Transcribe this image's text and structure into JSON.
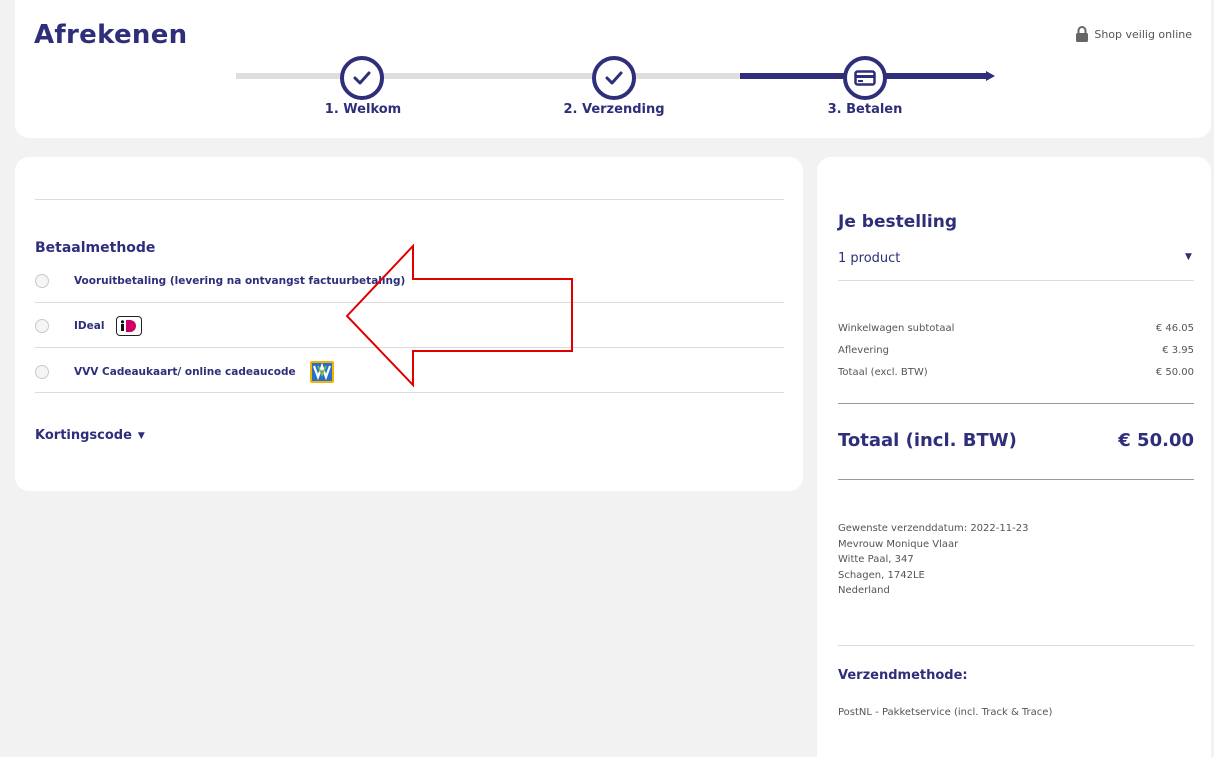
{
  "header": {
    "title": "Afrekenen",
    "secure_label": "Shop veilig online",
    "secure_icon": "lock-icon"
  },
  "stepper": {
    "steps": [
      {
        "label": "1. Welkom",
        "state": "done",
        "icon": "check-icon"
      },
      {
        "label": "2. Verzending",
        "state": "done",
        "icon": "check-icon"
      },
      {
        "label": "3. Betalen",
        "state": "current",
        "icon": "credit-card-icon"
      }
    ]
  },
  "payment": {
    "title": "Betaalmethode",
    "options": [
      {
        "label": "Vooruitbetaling (levering na ontvangst factuurbetaling)",
        "selected": false
      },
      {
        "label": "IDeal",
        "selected": false,
        "logo": "ideal-logo"
      },
      {
        "label": "VVV Cadeaukaart/ online cadeaucode",
        "selected": false,
        "logo": "vvv-logo"
      }
    ],
    "discount_label": "Kortingscode",
    "discount_caret": "▼"
  },
  "order": {
    "title": "Je bestelling",
    "product_count": "1 product",
    "caret": "▼",
    "lines": [
      {
        "label": "Winkelwagen subtotaal",
        "value": "€ 46.05"
      },
      {
        "label": "Aflevering",
        "value": "€ 3.95"
      },
      {
        "label": "Totaal (excl. BTW)",
        "value": "€ 50.00"
      }
    ],
    "total_label": "Totaal (incl. BTW)",
    "total_value": "€ 50.00",
    "address": [
      "Gewenste verzenddatum: 2022-11-23",
      "Mevrouw Monique Vlaar",
      "Witte Paal, 347",
      "Schagen, 1742LE",
      "Nederland"
    ],
    "shipping_title": "Verzendmethode:",
    "shipping_method": "PostNL - Pakketservice (incl. Track & Trace)"
  },
  "colors": {
    "brand": "#2e2e7a",
    "annotation": "#e00000",
    "background": "#f2f2f2"
  }
}
